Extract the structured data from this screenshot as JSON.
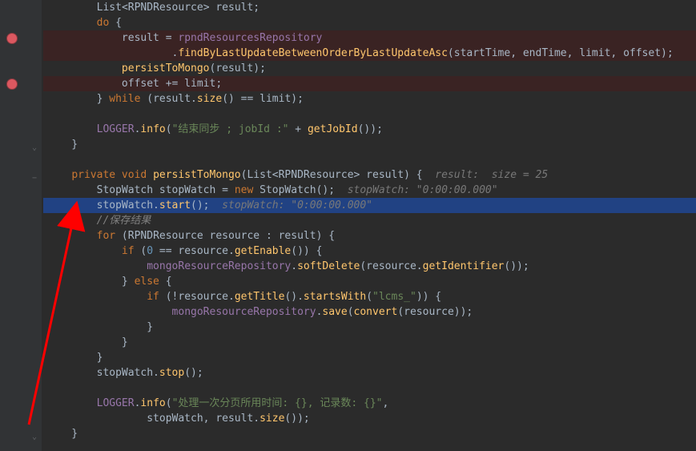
{
  "lines": {
    "l1": {
      "segs": [
        [
          "        ",
          0
        ],
        [
          "List",
          1
        ],
        [
          "<",
          0
        ],
        [
          "RPNDResource",
          1
        ],
        [
          "> result;",
          0
        ]
      ]
    },
    "l2": {
      "segs": [
        [
          "        ",
          0
        ],
        [
          "do",
          2
        ],
        [
          " {",
          0
        ]
      ]
    },
    "l3": {
      "segs": [
        [
          "            result = ",
          0
        ],
        [
          "rpndResourcesRepository",
          3
        ]
      ],
      "bp": true
    },
    "l4": {
      "segs": [
        [
          "                    .",
          0
        ],
        [
          "findByLastUpdateBetweenOrderByLastUpdateAsc",
          4
        ],
        [
          "(startTime, endTime, limit, offset);",
          0
        ]
      ],
      "bp": true
    },
    "l5": {
      "segs": [
        [
          "            ",
          0
        ],
        [
          "persistToMongo",
          4
        ],
        [
          "(result);",
          0
        ]
      ]
    },
    "l6": {
      "segs": [
        [
          "            offset += limit;",
          0
        ]
      ],
      "bp": true
    },
    "l7": {
      "segs": [
        [
          "        } ",
          0
        ],
        [
          "while",
          2
        ],
        [
          " (result.",
          0
        ],
        [
          "size",
          4
        ],
        [
          "() == limit);",
          0
        ]
      ]
    },
    "l8": {
      "segs": [
        [
          "",
          0
        ]
      ]
    },
    "l9": {
      "segs": [
        [
          "        ",
          0
        ],
        [
          "LOGGER",
          3
        ],
        [
          ".",
          0
        ],
        [
          "info",
          4
        ],
        [
          "(",
          0
        ],
        [
          "\"结束同步 ; jobId :\"",
          5
        ],
        [
          " + ",
          0
        ],
        [
          "getJobId",
          4
        ],
        [
          "());",
          0
        ]
      ]
    },
    "l10": {
      "segs": [
        [
          "    }",
          0
        ]
      ]
    },
    "l11": {
      "segs": [
        [
          "",
          0
        ]
      ]
    },
    "l12": {
      "segs": [
        [
          "    ",
          0
        ],
        [
          "private void",
          2
        ],
        [
          " ",
          0
        ],
        [
          "persistToMongo",
          4
        ],
        [
          "(",
          0
        ],
        [
          "List",
          1
        ],
        [
          "<",
          0
        ],
        [
          "RPNDResource",
          1
        ],
        [
          "> result) {  ",
          0
        ],
        [
          "result:  size = 25",
          6
        ]
      ]
    },
    "l13": {
      "segs": [
        [
          "        StopWatch stopWatch = ",
          0
        ],
        [
          "new",
          2
        ],
        [
          " StopWatch();  ",
          0
        ],
        [
          "stopWatch: \"0:00:00.000\"",
          6
        ]
      ]
    },
    "l14": {
      "segs": [
        [
          "        stopWatch.",
          0
        ],
        [
          "start",
          4
        ],
        [
          "();  ",
          0
        ],
        [
          "stopWatch: \"0:00:00.000\"",
          6
        ]
      ],
      "cur": true
    },
    "l15": {
      "segs": [
        [
          "        ",
          0
        ],
        [
          "//保存结果",
          7
        ]
      ]
    },
    "l16": {
      "segs": [
        [
          "        ",
          0
        ],
        [
          "for",
          2
        ],
        [
          " (RPNDResource resource : result) {",
          0
        ]
      ]
    },
    "l17": {
      "segs": [
        [
          "            ",
          0
        ],
        [
          "if",
          2
        ],
        [
          " (",
          0
        ],
        [
          "0",
          8
        ],
        [
          " == resource.",
          0
        ],
        [
          "getEnable",
          4
        ],
        [
          "()) {",
          0
        ]
      ]
    },
    "l18": {
      "segs": [
        [
          "                ",
          0
        ],
        [
          "mongoResourceRepository",
          3
        ],
        [
          ".",
          0
        ],
        [
          "softDelete",
          4
        ],
        [
          "(resource.",
          0
        ],
        [
          "getIdentifier",
          4
        ],
        [
          "());",
          0
        ]
      ]
    },
    "l19": {
      "segs": [
        [
          "            } ",
          0
        ],
        [
          "else",
          2
        ],
        [
          " {",
          0
        ]
      ]
    },
    "l20": {
      "segs": [
        [
          "                ",
          0
        ],
        [
          "if",
          2
        ],
        [
          " (!resource.",
          0
        ],
        [
          "getTitle",
          4
        ],
        [
          "().",
          0
        ],
        [
          "startsWith",
          4
        ],
        [
          "(",
          0
        ],
        [
          "\"lcms_\"",
          5
        ],
        [
          ")) {",
          0
        ]
      ]
    },
    "l21": {
      "segs": [
        [
          "                    ",
          0
        ],
        [
          "mongoResourceRepository",
          3
        ],
        [
          ".",
          0
        ],
        [
          "save",
          4
        ],
        [
          "(",
          0
        ],
        [
          "convert",
          4
        ],
        [
          "(resource));",
          0
        ]
      ]
    },
    "l22": {
      "segs": [
        [
          "                }",
          0
        ]
      ]
    },
    "l23": {
      "segs": [
        [
          "            }",
          0
        ]
      ]
    },
    "l24": {
      "segs": [
        [
          "        }",
          0
        ]
      ]
    },
    "l25": {
      "segs": [
        [
          "        stopWatch.",
          0
        ],
        [
          "stop",
          4
        ],
        [
          "();",
          0
        ]
      ]
    },
    "l26": {
      "segs": [
        [
          "",
          0
        ]
      ]
    },
    "l27": {
      "segs": [
        [
          "        ",
          0
        ],
        [
          "LOGGER",
          3
        ],
        [
          ".",
          0
        ],
        [
          "info",
          4
        ],
        [
          "(",
          0
        ],
        [
          "\"处理一次分页所用时间: {}, 记录数: {}\"",
          5
        ],
        [
          ",",
          0
        ]
      ]
    },
    "l28": {
      "segs": [
        [
          "                stopWatch, result.",
          0
        ],
        [
          "size",
          4
        ],
        [
          "());",
          0
        ]
      ]
    },
    "l29": {
      "segs": [
        [
          "    }",
          0
        ]
      ]
    }
  },
  "gutter": {
    "breakpoints": [
      3,
      6
    ],
    "folds_minus": [
      10,
      12,
      29
    ],
    "folds_end": [
      10,
      29
    ]
  }
}
